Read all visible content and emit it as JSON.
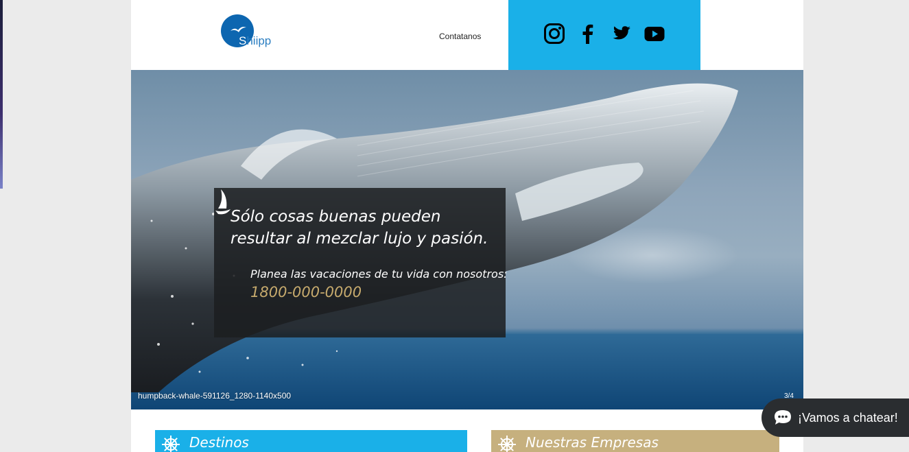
{
  "header": {
    "logo_text_first": "S",
    "logo_text_rest": "hiipp",
    "nav_link": "Contatanos"
  },
  "social": {
    "icons": [
      "instagram-icon",
      "facebook-icon",
      "twitter-icon",
      "youtube-icon"
    ],
    "bar_color": "#1ab0e8"
  },
  "hero": {
    "headline": "Sólo cosas buenas pueden resultar al mezclar lujo y pasión.",
    "plan_text": "Planea las vacaciones de tu vida con nosotros:",
    "phone": "1800-000-0000",
    "image_label": "humpback-whale-591126_1280-1140x500",
    "slide_counter": "3/4"
  },
  "cards": [
    {
      "title": "Destinos",
      "color": "#1ab0e8"
    },
    {
      "title": "Nuestras Empresas",
      "color": "#c6b07e"
    }
  ],
  "chat": {
    "label": "¡Vamos a chatear!"
  },
  "colors": {
    "accent_blue": "#1ab0e8",
    "accent_gold": "#c6aa6d",
    "logo_blue": "#0d66b0"
  }
}
